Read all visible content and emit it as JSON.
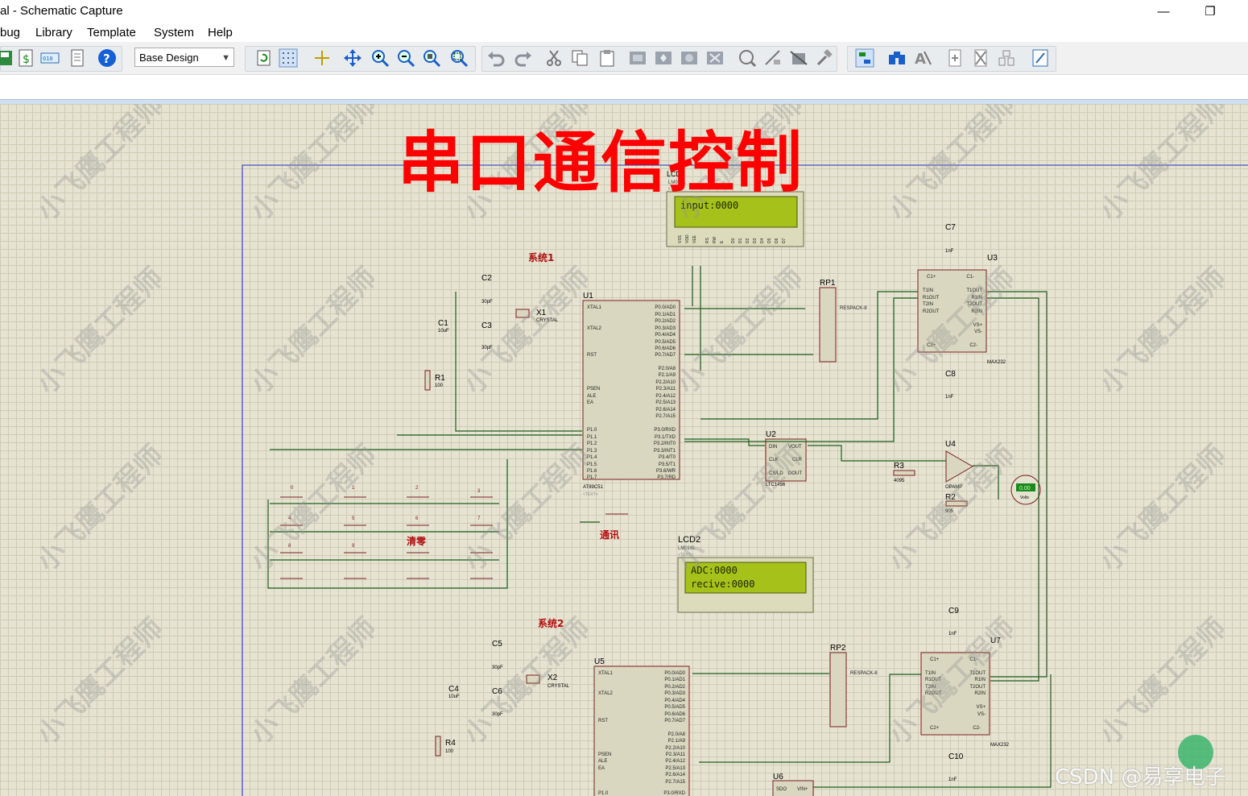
{
  "window": {
    "title": "al - Schematic Capture",
    "restore_glyph": "❐",
    "minimize_glyph": "—"
  },
  "menu": [
    "bug",
    "Library",
    "Template",
    "System",
    "Help"
  ],
  "toolbar": {
    "design_select": "Base Design",
    "icons": [
      "save-icon",
      "bill-of-materials-icon",
      "netlist-icon",
      "report-icon",
      "help-icon",
      "refresh-icon",
      "grid-icon",
      "origin-icon",
      "pan-icon",
      "zoom-in-icon",
      "zoom-out-icon",
      "zoom-all-icon",
      "zoom-area-icon",
      "undo-icon",
      "redo-icon",
      "cut-icon",
      "copy-icon",
      "paste-icon",
      "block-copy-icon",
      "block-move-icon",
      "block-rotate-icon",
      "block-delete-icon",
      "pick-device-icon",
      "make-device-icon",
      "package-tool-icon",
      "decompose-icon",
      "wire-autoroute-icon",
      "search-icon",
      "property-assign-icon",
      "new-sheet-icon",
      "remove-sheet-icon",
      "exit-to-parent-icon",
      "design-explorer-icon"
    ]
  },
  "schematic": {
    "banner": "串口通信控制",
    "watermark": "小飞鹰工程师",
    "system1_label": "系统1",
    "system2_label": "系统2",
    "lcd1": {
      "ref": "LCD1",
      "model": "LM016L",
      "line1": "input:0000",
      "line2": ""
    },
    "lcd2": {
      "ref": "LCD2",
      "model": "LM016L",
      "line1": "ADC:0000",
      "line2": "recive:0000"
    },
    "u1": {
      "ref": "U1",
      "model": "AT89C51",
      "left_pins": [
        "XTAL1",
        "XTAL2",
        "RST",
        "PSEN",
        "ALE",
        "EA",
        "P1.0",
        "P1.1",
        "P1.2",
        "P1.3",
        "P1.4",
        "P1.5",
        "P1.6",
        "P1.7"
      ],
      "right_pins": [
        "P0.0/AD0",
        "P0.1/AD1",
        "P0.2/AD2",
        "P0.3/AD3",
        "P0.4/AD4",
        "P0.5/AD5",
        "P0.6/AD6",
        "P0.7/AD7",
        "P2.0/A8",
        "P2.1/A9",
        "P2.2/A10",
        "P2.3/A11",
        "P2.4/A12",
        "P2.5/A13",
        "P2.6/A14",
        "P2.7/A15",
        "P3.0/RXD",
        "P3.1/TXD",
        "P3.2/INT0",
        "P3.3/INT1",
        "P3.4/T0",
        "P3.5/T1",
        "P3.6/WR",
        "P3.7/RD"
      ]
    },
    "u5": {
      "ref": "U5",
      "left_pins": [
        "XTAL1",
        "XTAL2",
        "RST",
        "PSEN",
        "ALE",
        "EA",
        "P1.0"
      ],
      "right_pins": [
        "P0.0/AD0",
        "P0.1/AD1",
        "P0.2/AD2",
        "P0.3/AD3",
        "P0.4/AD4",
        "P0.5/AD5",
        "P0.6/AD6",
        "P0.7/AD7",
        "P2.0/A8",
        "P2.1/A9",
        "P2.2/A10",
        "P2.3/A11",
        "P2.4/A12",
        "P2.5/A13",
        "P2.6/A14",
        "P2.7/A15",
        "P3.0/RXD"
      ]
    },
    "u2": {
      "ref": "U2",
      "model": "LTC1456",
      "pins": [
        "DIN",
        "VOUT",
        "CLK",
        "CLR",
        "CS/LD",
        "DOUT"
      ]
    },
    "u3": {
      "ref": "U3",
      "model": "MAX232",
      "left_pins": [
        "C1+",
        "T1IN",
        "R1OUT",
        "T2IN",
        "R2OUT",
        "C2+"
      ],
      "right_pins": [
        "C1-",
        "T1OUT",
        "R1IN",
        "T2OUT",
        "R2IN",
        "VS+",
        "VS-",
        "C2-"
      ]
    },
    "u7": {
      "ref": "U7",
      "model": "MAX232",
      "left_pins": [
        "C1+",
        "T1IN",
        "R1OUT",
        "T2IN",
        "R2OUT",
        "C2+"
      ],
      "right_pins": [
        "C1-",
        "T1OUT",
        "R1IN",
        "T2OUT",
        "R2IN",
        "VS+",
        "VS-",
        "C2-"
      ]
    },
    "u4": {
      "ref": "U4",
      "model": "OPAMP"
    },
    "u6": {
      "ref": "U6",
      "pins": [
        "SDO",
        "VIN+"
      ]
    },
    "rp1": {
      "ref": "RP1",
      "model": "RESPACK-8"
    },
    "rp2": {
      "ref": "RP2",
      "model": "RESPACK-8"
    },
    "c1": {
      "ref": "C1",
      "value": "10uF"
    },
    "c2": {
      "ref": "C2",
      "value": "30pF"
    },
    "c3": {
      "ref": "C3",
      "value": "30pF"
    },
    "c4": {
      "ref": "C4",
      "value": "10uF"
    },
    "c5": {
      "ref": "C5",
      "value": "30pF"
    },
    "c6": {
      "ref": "C6",
      "value": "30pF"
    },
    "c7": {
      "ref": "C7",
      "value": "1nF"
    },
    "c8": {
      "ref": "C8",
      "value": "1nF"
    },
    "c9": {
      "ref": "C9",
      "value": "1nF"
    },
    "c10": {
      "ref": "C10",
      "value": "1nF"
    },
    "x1": {
      "ref": "X1",
      "model": "CRYSTAL"
    },
    "x2": {
      "ref": "X2",
      "model": "CRYSTAL"
    },
    "r1": {
      "ref": "R1",
      "value": "100"
    },
    "r2": {
      "ref": "R2",
      "value": "905"
    },
    "r3": {
      "ref": "R3",
      "value": "4095"
    },
    "r4": {
      "ref": "R4",
      "value": "100"
    },
    "voltmeter": {
      "reading": "0.00",
      "unit": "Volts"
    },
    "text_placeholder": "<TEXT>",
    "keypad_labels": [
      "0",
      "1",
      "2",
      "3",
      "4",
      "5",
      "6",
      "7",
      "8",
      "9"
    ],
    "clear_label": "清零",
    "comm_label": "通讯"
  },
  "footer": {
    "csdn": "CSDN @易享电子"
  }
}
